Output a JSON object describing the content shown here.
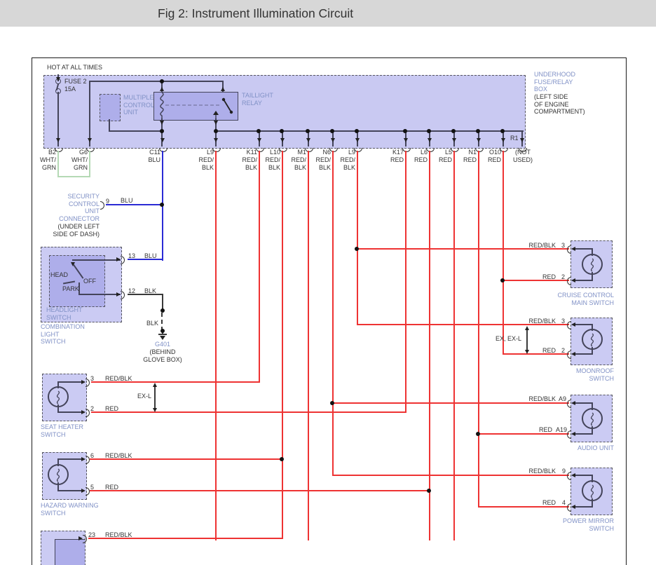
{
  "title": "Fig 2: Instrument Illumination Circuit",
  "colors": {
    "wire_red": "#ee3333",
    "wire_blue": "#2b2bd5",
    "wire_green": "#b5d9b5",
    "wire_black": "#3a3a3a",
    "label_blue": "#8091c6",
    "box_fill": "#cbcbf3",
    "inner_fill": "#aeaeea"
  },
  "fusebox": {
    "hot": "HOT AT ALL TIMES",
    "fuse": "FUSE 2\n15A",
    "multiplex": "MULTIPLEX\nCONTROL\nUNIT",
    "relay": "TAILLIGHT\nRELAY",
    "name_blue": "UNDERHOOD\nFUSE/RELAY\nBOX",
    "name_black": "(LEFT SIDE\nOF ENGINE\nCOMPARTMENT)",
    "r1_pin": "R1",
    "r1_note": "(NOT\nUSED)"
  },
  "connectors": [
    {
      "pin": "B2",
      "wire": "WHT/\nGRN"
    },
    {
      "pin": "G6",
      "wire": "WHT/\nGRN"
    },
    {
      "pin": "C11",
      "wire": "BLU"
    },
    {
      "pin": "L9",
      "wire": "RED/\nBLK"
    },
    {
      "pin": "K11",
      "wire": "RED/\nBLK"
    },
    {
      "pin": "L10",
      "wire": "RED/\nBLK"
    },
    {
      "pin": "M1",
      "wire": "RED/\nBLK"
    },
    {
      "pin": "N6",
      "wire": "RED/\nBLK"
    },
    {
      "pin": "L9",
      "wire": "RED/\nBLK"
    },
    {
      "pin": "K17",
      "wire": "RED"
    },
    {
      "pin": "L6",
      "wire": "RED"
    },
    {
      "pin": "L5",
      "wire": "RED"
    },
    {
      "pin": "N1",
      "wire": "RED"
    },
    {
      "pin": "O10",
      "wire": "RED"
    }
  ],
  "security": {
    "pin": "9",
    "wire": "BLU",
    "name": "SECURITY\nCONTROL\nUNIT\nCONNECTOR",
    "location": "(UNDER LEFT\nSIDE OF DASH)"
  },
  "headlight": {
    "pin_top": "13",
    "wire_top": "BLU",
    "pin_bot": "12",
    "wire_bot": "BLK",
    "pos_head": "HEAD",
    "pos_off": "OFF",
    "pos_park": "PARK",
    "inner_name": "HEADLIGHT\nSWITCH",
    "outer_name": "COMBINATION\nLIGHT\nSWITCH"
  },
  "ground": {
    "wire": "BLK",
    "name": "G401",
    "location": "(BEHIND\nGLOVE BOX)"
  },
  "seat_heater": {
    "pin_top": "3",
    "wire_top": "RED/BLK",
    "pin_bot": "2",
    "wire_bot": "RED",
    "trim": "EX-L",
    "name": "SEAT HEATER\nSWITCH"
  },
  "hazard": {
    "pin_top": "6",
    "wire_top": "RED/BLK",
    "pin_bot": "5",
    "wire_bot": "RED",
    "name": "HAZARD WARNING\nSWITCH"
  },
  "partial": {
    "pin": "23",
    "wire": "RED/BLK"
  },
  "cruise": {
    "pin_top": "3",
    "wire_top": "RED/BLK",
    "pin_bot": "2",
    "wire_bot": "RED",
    "name": "CRUISE CONTROL\nMAIN SWITCH"
  },
  "moonroof": {
    "pin_top": "3",
    "wire_top": "RED/BLK",
    "pin_bot": "2",
    "wire_bot": "RED",
    "trim": "EX, EX-L",
    "name": "MOONROOF\nSWITCH"
  },
  "audio": {
    "pin_top": "A9",
    "wire_top": "RED/BLK",
    "pin_bot": "A19",
    "wire_bot": "RED",
    "name": "AUDIO UNIT"
  },
  "power_mirror": {
    "pin_top": "9",
    "wire_top": "RED/BLK",
    "pin_bot": "4",
    "wire_bot": "RED",
    "name": "POWER MIRROR\nSWITCH"
  }
}
